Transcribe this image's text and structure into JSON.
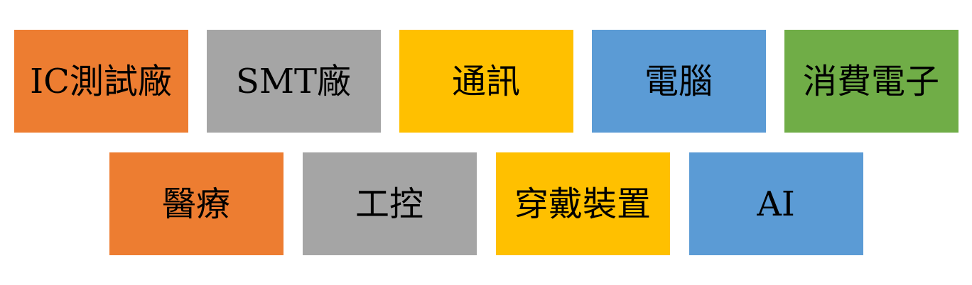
{
  "colors": {
    "orange": "#ED7D31",
    "gray": "#A5A5A5",
    "gold": "#FFC000",
    "blue": "#5B9BD5",
    "green": "#70AD47"
  },
  "row1": [
    {
      "label": "IC測試廠",
      "color": "#ED7D31"
    },
    {
      "label": "SMT廠",
      "color": "#A5A5A5"
    },
    {
      "label": "通訊",
      "color": "#FFC000"
    },
    {
      "label": "電腦",
      "color": "#5B9BD5"
    },
    {
      "label": "消費電子",
      "color": "#70AD47"
    }
  ],
  "row2": [
    {
      "label": "醫療",
      "color": "#ED7D31"
    },
    {
      "label": "工控",
      "color": "#A5A5A5"
    },
    {
      "label": "穿戴裝置",
      "color": "#FFC000"
    },
    {
      "label": "AI",
      "color": "#5B9BD5"
    }
  ]
}
